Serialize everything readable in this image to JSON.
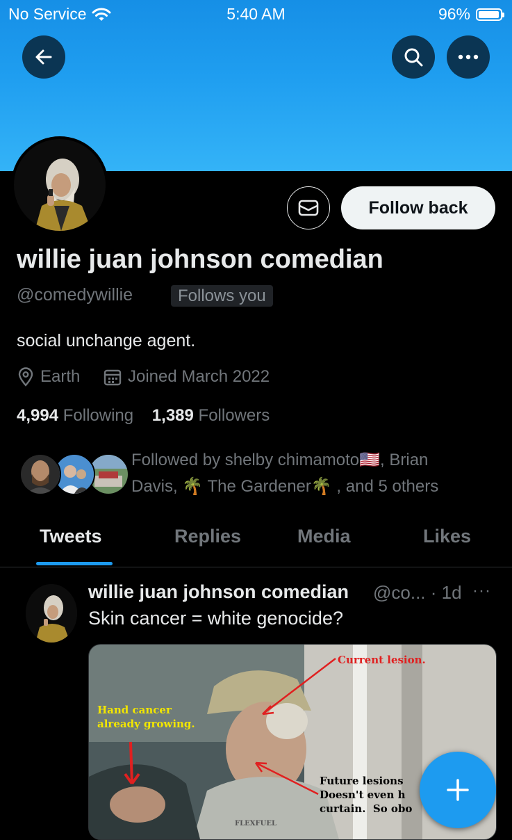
{
  "status_bar": {
    "carrier": "No Service",
    "time": "5:40 AM",
    "battery_text": "96%",
    "battery_level": 0.96
  },
  "header": {
    "back_icon": "arrow-left-icon",
    "search_icon": "search-icon",
    "more_icon": "more-horizontal-icon"
  },
  "profile": {
    "display_name": "willie juan johnson comedian",
    "handle": "@comedywillie",
    "follows_you_badge": "Follows you",
    "bio": "social unchange agent.",
    "location": "Earth",
    "joined": "Joined March 2022",
    "following_count": "4,994",
    "following_label": "Following",
    "followers_count": "1,389",
    "followers_label": "Followers",
    "follow_button": "Follow back",
    "followed_by_text": "Followed by shelby chimamoto🇺🇸, Brian Davis, 🌴 The Gardener🌴 , and 5 others"
  },
  "tabs": [
    {
      "label": "Tweets",
      "active": true
    },
    {
      "label": "Replies",
      "active": false
    },
    {
      "label": "Media",
      "active": false
    },
    {
      "label": "Likes",
      "active": false
    }
  ],
  "tweet": {
    "author": "willie juan johnson comedian",
    "handle_truncated": "@co...",
    "time": "· 1d",
    "more": "···",
    "text": "Skin cancer = white genocide?",
    "media_labels": {
      "current": "Current lesion.",
      "hand": "Hand cancer\nalready growing.",
      "future": "Future lesions\nDoesn't even h\ncurtain.  So obo",
      "brand": "FLEXFUEL"
    }
  },
  "colors": {
    "accent": "#1d9bf0",
    "background": "#000000",
    "muted_text": "#71767b",
    "banner": "#1f9ef0"
  }
}
